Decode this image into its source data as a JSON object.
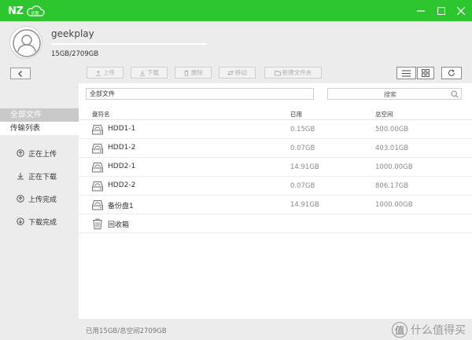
{
  "app": {
    "logo_text": "NZ",
    "logo_sub": "云盘",
    "accent_color": "#2ec62e"
  },
  "user": {
    "name": "geekplay",
    "quota_text": "15GB/2709GB",
    "quota_fraction": 0.0055
  },
  "sidebar": {
    "all_files": "全部文件",
    "transfer_list": "传输列表",
    "items": [
      {
        "label": "正在上传",
        "icon": "upload-circle-icon"
      },
      {
        "label": "正在下载",
        "icon": "download-arrow-icon"
      },
      {
        "label": "上传完成",
        "icon": "upload-done-icon"
      },
      {
        "label": "下载完成",
        "icon": "download-done-icon"
      }
    ]
  },
  "toolbar": {
    "upload": "上传",
    "download": "下载",
    "delete": "删除",
    "move": "移动",
    "new_folder": "新建文件夹"
  },
  "pathbar": {
    "path": "全部文件",
    "search_placeholder": "搜索"
  },
  "table": {
    "headers": {
      "name": "盘符名",
      "used": "已用",
      "total": "总空间"
    },
    "rows": [
      {
        "name": "HDD1-1",
        "used": "0.15GB",
        "total": "500.00GB",
        "icon": "hard-drive-icon"
      },
      {
        "name": "HDD1-2",
        "used": "0.07GB",
        "total": "403.01GB",
        "icon": "hard-drive-icon"
      },
      {
        "name": "HDD2-1",
        "used": "14.91GB",
        "total": "1000.00GB",
        "icon": "hard-drive-icon"
      },
      {
        "name": "HDD2-2",
        "used": "0.07GB",
        "total": "806.17GB",
        "icon": "hard-drive-icon"
      },
      {
        "name": "备份盘1",
        "used": "14.91GB",
        "total": "1000.00GB",
        "icon": "hard-drive-icon"
      },
      {
        "name": "回收箱",
        "used": "",
        "total": "",
        "icon": "recycle-bin-icon"
      }
    ]
  },
  "status": {
    "text": "已用15GB/总空间2709GB"
  },
  "watermark": {
    "badge": "值",
    "text": "什么值得买"
  }
}
